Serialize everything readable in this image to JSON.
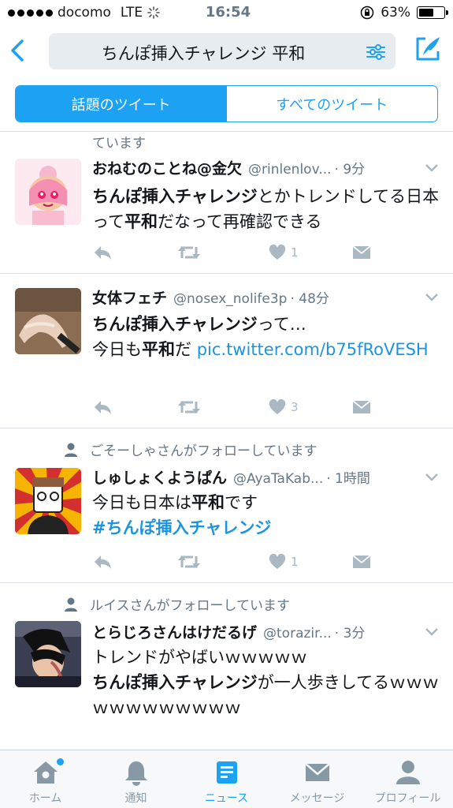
{
  "status_bar": {
    "carrier": "docomo",
    "network": "LTE",
    "time": "16:54",
    "battery": "63%",
    "battery_level": 0.63
  },
  "nav": {
    "search_query": "ちんぽ挿入チャレンジ 平和"
  },
  "segments": {
    "top": "話題のツイート",
    "all": "すべてのツイート"
  },
  "feed": {
    "cut_off_text": "ています",
    "tweets": [
      {
        "name": "おねむのことね@金欠",
        "handle": "@rinlenlov...",
        "time": "· 9分",
        "body_bold_1": "ちんぽ挿入チャレンジ",
        "body_text_1": "とかトレンドしてる日本って",
        "body_bold_2": "平和",
        "body_text_2": "だなって再確認できる",
        "likes": "1"
      },
      {
        "name": "女体フェチ",
        "handle": "@nosex_nolife3p",
        "time": "· 48分",
        "body_bold_1": "ちんぽ挿入チャレンジ",
        "body_text_1": "って…",
        "body_text_2": "今日も",
        "body_bold_2": "平和",
        "body_text_3": "だ ",
        "link": "pic.twitter.com/b75fRoVESH",
        "likes": "3"
      },
      {
        "social_context": "ごそーしゃさんがフォローしています",
        "name": "しゅしょくようぱん",
        "handle": "@AyaTaKab...",
        "time": "· 1時間",
        "body_text_1": "今日も日本は",
        "body_bold_1": "平和",
        "body_text_2": "です",
        "hashtag": "#ちんぽ挿入チャレンジ",
        "likes": "1"
      },
      {
        "social_context": "ルイスさんがフォローしています",
        "name": "とらじろさんはけだるげ",
        "handle": "@torazir...",
        "time": "· 3分",
        "body_text_1": "トレンドがやばいｗｗｗｗｗ",
        "body_bold_1": "ちんぽ挿入チャレンジ",
        "body_text_2": "が一人歩きしてるｗｗｗｗｗｗｗｗｗｗｗｗ"
      }
    ]
  },
  "tabbar": {
    "home": "ホーム",
    "notifications": "通知",
    "news": "ニュース",
    "messages": "メッセージ",
    "profile": "プロフィール"
  },
  "colors": {
    "accent": "#1da1f2",
    "link": "#1b95e0",
    "secondary_text": "#657786",
    "action_icon": "#aab8c2"
  }
}
